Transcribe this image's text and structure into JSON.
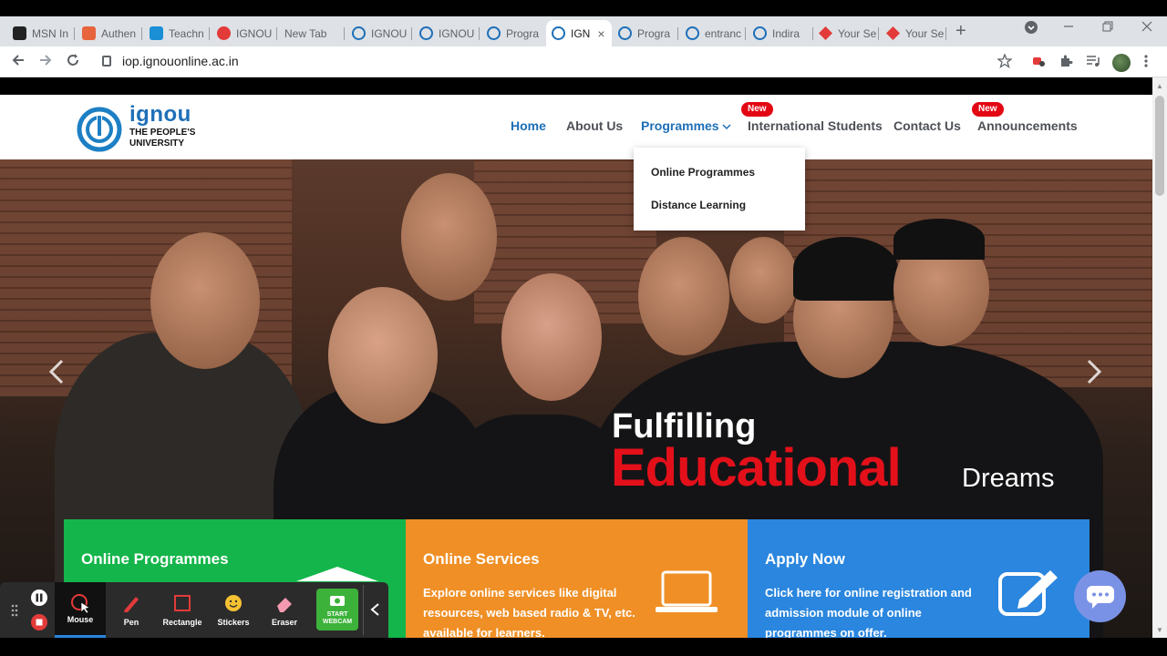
{
  "browser": {
    "tabs": [
      {
        "label": "MSN In",
        "color": "#222222"
      },
      {
        "label": "Authen",
        "color": "#e8643c"
      },
      {
        "label": "Teachn",
        "color": "#1a8fd6"
      },
      {
        "label": "IGNOU",
        "color": "#e33a3a"
      },
      {
        "label": "New Tab",
        "color": "#dee1e6"
      },
      {
        "label": "IGNOU",
        "color": "#1d6fb8"
      },
      {
        "label": "IGNOU",
        "color": "#1d6fb8"
      },
      {
        "label": "Progra",
        "color": "#1d6fb8"
      },
      {
        "label": "IGN",
        "color": "#1d6fb8"
      },
      {
        "label": "Progra",
        "color": "#1d6fb8"
      },
      {
        "label": "entranc",
        "color": "#1d6fb8"
      },
      {
        "label": "Indira",
        "color": "#1d6fb8"
      },
      {
        "label": "Your Se",
        "color": "#e33a3a"
      },
      {
        "label": "Your Se",
        "color": "#e33a3a"
      }
    ],
    "new_tab_symbol": "+",
    "tab_close_symbol": "×",
    "url": "iop.ignouonline.ac.in",
    "nav_icons": {
      "back": "back-arrow-icon",
      "forward": "forward-arrow-icon",
      "reload": "reload-icon"
    }
  },
  "site": {
    "logo": {
      "name": "ignou",
      "line1": "THE PEOPLE'S",
      "line2": "UNIVERSITY"
    },
    "nav": {
      "home": "Home",
      "about": "About Us",
      "programmes": "Programmes",
      "international": "International Students",
      "contact": "Contact Us",
      "announcements": "Announcements",
      "badge": "New"
    },
    "dropdown": [
      "Online Programmes",
      "Distance Learning"
    ],
    "hero": {
      "line1": "Fulfilling",
      "line2": "Educational",
      "line3": "Dreams"
    },
    "cards": [
      {
        "title": "Online Programmes",
        "desc": "",
        "color": "#14b54a"
      },
      {
        "title": "Online Services",
        "desc": "Explore online services like digital resources, web based radio & TV, etc. available for learners.",
        "color": "#ef8f25"
      },
      {
        "title": "Apply Now",
        "desc": "Click here for online registration and admission module of online programmes on offer.",
        "color": "#2a86de"
      }
    ]
  },
  "drawing_toolbar": {
    "tools": [
      "Mouse",
      "Pen",
      "Rectangle",
      "Stickers",
      "Eraser"
    ],
    "webcam_line1": "START",
    "webcam_line2": "WEBCAM"
  }
}
